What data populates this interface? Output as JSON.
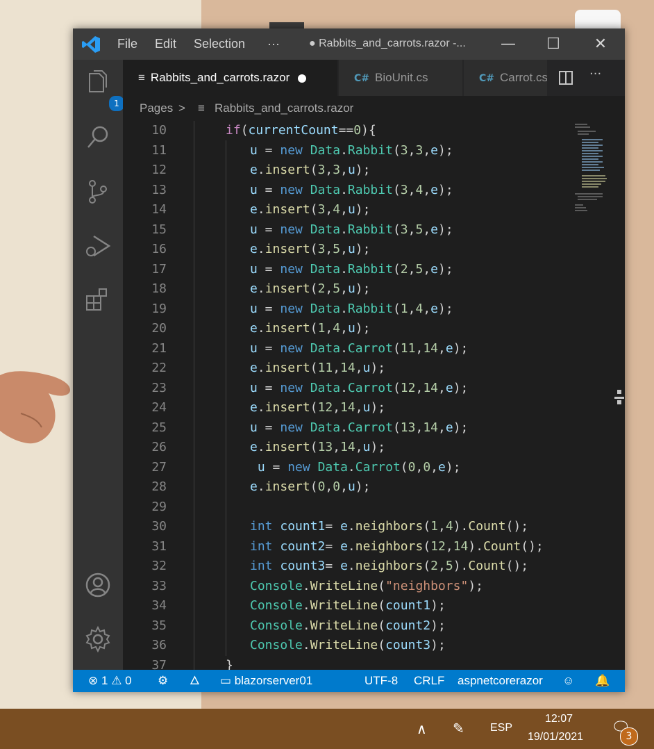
{
  "window": {
    "menu": [
      "File",
      "Edit",
      "Selection",
      "···"
    ],
    "title": "● Rabbits_and_carrots.razor -...",
    "controls": [
      "—",
      "☐",
      "✕"
    ]
  },
  "activity": {
    "explorer_badge": "1"
  },
  "tabs": [
    {
      "label": "Rabbits_and_carrots.razor",
      "modified": true,
      "active": true
    },
    {
      "label": "BioUnit.cs",
      "active": false
    },
    {
      "label": "Carrot.cs",
      "active": false
    }
  ],
  "tab_actions": {
    "more": "···"
  },
  "breadcrumb": {
    "folder": "Pages",
    "separator": ">",
    "file": "Rabbits_and_carrots.razor"
  },
  "code": [
    {
      "n": "10",
      "indent": 0,
      "parts": [
        [
          "ctrl",
          "if"
        ],
        [
          "pun",
          "("
        ],
        [
          "var",
          "currentCount"
        ],
        [
          "pun",
          "=="
        ],
        [
          "num",
          "0"
        ],
        [
          "pun",
          "){"
        ]
      ]
    },
    {
      "n": "11",
      "indent": 1,
      "parts": [
        [
          "var",
          "u"
        ],
        [
          "pun",
          " = "
        ],
        [
          "kw",
          "new"
        ],
        [
          "pun",
          " "
        ],
        [
          "typ",
          "Data"
        ],
        [
          "pun",
          "."
        ],
        [
          "typ",
          "Rabbit"
        ],
        [
          "pun",
          "("
        ],
        [
          "num",
          "3"
        ],
        [
          "pun",
          ","
        ],
        [
          "num",
          "3"
        ],
        [
          "pun",
          ","
        ],
        [
          "var",
          "e"
        ],
        [
          "pun",
          ");"
        ]
      ]
    },
    {
      "n": "12",
      "indent": 1,
      "parts": [
        [
          "var",
          "e"
        ],
        [
          "pun",
          "."
        ],
        [
          "fn",
          "insert"
        ],
        [
          "pun",
          "("
        ],
        [
          "num",
          "3"
        ],
        [
          "pun",
          ","
        ],
        [
          "num",
          "3"
        ],
        [
          "pun",
          ","
        ],
        [
          "var",
          "u"
        ],
        [
          "pun",
          ");"
        ]
      ]
    },
    {
      "n": "13",
      "indent": 1,
      "parts": [
        [
          "var",
          "u"
        ],
        [
          "pun",
          " = "
        ],
        [
          "kw",
          "new"
        ],
        [
          "pun",
          " "
        ],
        [
          "typ",
          "Data"
        ],
        [
          "pun",
          "."
        ],
        [
          "typ",
          "Rabbit"
        ],
        [
          "pun",
          "("
        ],
        [
          "num",
          "3"
        ],
        [
          "pun",
          ","
        ],
        [
          "num",
          "4"
        ],
        [
          "pun",
          ","
        ],
        [
          "var",
          "e"
        ],
        [
          "pun",
          ");"
        ]
      ]
    },
    {
      "n": "14",
      "indent": 1,
      "parts": [
        [
          "var",
          "e"
        ],
        [
          "pun",
          "."
        ],
        [
          "fn",
          "insert"
        ],
        [
          "pun",
          "("
        ],
        [
          "num",
          "3"
        ],
        [
          "pun",
          ","
        ],
        [
          "num",
          "4"
        ],
        [
          "pun",
          ","
        ],
        [
          "var",
          "u"
        ],
        [
          "pun",
          ");"
        ]
      ]
    },
    {
      "n": "15",
      "indent": 1,
      "parts": [
        [
          "var",
          "u"
        ],
        [
          "pun",
          " = "
        ],
        [
          "kw",
          "new"
        ],
        [
          "pun",
          " "
        ],
        [
          "typ",
          "Data"
        ],
        [
          "pun",
          "."
        ],
        [
          "typ",
          "Rabbit"
        ],
        [
          "pun",
          "("
        ],
        [
          "num",
          "3"
        ],
        [
          "pun",
          ","
        ],
        [
          "num",
          "5"
        ],
        [
          "pun",
          ","
        ],
        [
          "var",
          "e"
        ],
        [
          "pun",
          ");"
        ]
      ]
    },
    {
      "n": "16",
      "indent": 1,
      "parts": [
        [
          "var",
          "e"
        ],
        [
          "pun",
          "."
        ],
        [
          "fn",
          "insert"
        ],
        [
          "pun",
          "("
        ],
        [
          "num",
          "3"
        ],
        [
          "pun",
          ","
        ],
        [
          "num",
          "5"
        ],
        [
          "pun",
          ","
        ],
        [
          "var",
          "u"
        ],
        [
          "pun",
          ");"
        ]
      ]
    },
    {
      "n": "17",
      "indent": 1,
      "parts": [
        [
          "var",
          "u"
        ],
        [
          "pun",
          " = "
        ],
        [
          "kw",
          "new"
        ],
        [
          "pun",
          " "
        ],
        [
          "typ",
          "Data"
        ],
        [
          "pun",
          "."
        ],
        [
          "typ",
          "Rabbit"
        ],
        [
          "pun",
          "("
        ],
        [
          "num",
          "2"
        ],
        [
          "pun",
          ","
        ],
        [
          "num",
          "5"
        ],
        [
          "pun",
          ","
        ],
        [
          "var",
          "e"
        ],
        [
          "pun",
          ");"
        ]
      ]
    },
    {
      "n": "18",
      "indent": 1,
      "parts": [
        [
          "var",
          "e"
        ],
        [
          "pun",
          "."
        ],
        [
          "fn",
          "insert"
        ],
        [
          "pun",
          "("
        ],
        [
          "num",
          "2"
        ],
        [
          "pun",
          ","
        ],
        [
          "num",
          "5"
        ],
        [
          "pun",
          ","
        ],
        [
          "var",
          "u"
        ],
        [
          "pun",
          ");"
        ]
      ]
    },
    {
      "n": "19",
      "indent": 1,
      "parts": [
        [
          "var",
          "u"
        ],
        [
          "pun",
          " = "
        ],
        [
          "kw",
          "new"
        ],
        [
          "pun",
          " "
        ],
        [
          "typ",
          "Data"
        ],
        [
          "pun",
          "."
        ],
        [
          "typ",
          "Rabbit"
        ],
        [
          "pun",
          "("
        ],
        [
          "num",
          "1"
        ],
        [
          "pun",
          ","
        ],
        [
          "num",
          "4"
        ],
        [
          "pun",
          ","
        ],
        [
          "var",
          "e"
        ],
        [
          "pun",
          ");"
        ]
      ]
    },
    {
      "n": "20",
      "indent": 1,
      "parts": [
        [
          "var",
          "e"
        ],
        [
          "pun",
          "."
        ],
        [
          "fn",
          "insert"
        ],
        [
          "pun",
          "("
        ],
        [
          "num",
          "1"
        ],
        [
          "pun",
          ","
        ],
        [
          "num",
          "4"
        ],
        [
          "pun",
          ","
        ],
        [
          "var",
          "u"
        ],
        [
          "pun",
          ");"
        ]
      ]
    },
    {
      "n": "21",
      "indent": 1,
      "parts": [
        [
          "var",
          "u"
        ],
        [
          "pun",
          " = "
        ],
        [
          "kw",
          "new"
        ],
        [
          "pun",
          " "
        ],
        [
          "typ",
          "Data"
        ],
        [
          "pun",
          "."
        ],
        [
          "typ",
          "Carrot"
        ],
        [
          "pun",
          "("
        ],
        [
          "num",
          "11"
        ],
        [
          "pun",
          ","
        ],
        [
          "num",
          "14"
        ],
        [
          "pun",
          ","
        ],
        [
          "var",
          "e"
        ],
        [
          "pun",
          ");"
        ]
      ]
    },
    {
      "n": "22",
      "indent": 1,
      "parts": [
        [
          "var",
          "e"
        ],
        [
          "pun",
          "."
        ],
        [
          "fn",
          "insert"
        ],
        [
          "pun",
          "("
        ],
        [
          "num",
          "11"
        ],
        [
          "pun",
          ","
        ],
        [
          "num",
          "14"
        ],
        [
          "pun",
          ","
        ],
        [
          "var",
          "u"
        ],
        [
          "pun",
          ");"
        ]
      ]
    },
    {
      "n": "23",
      "indent": 1,
      "parts": [
        [
          "var",
          "u"
        ],
        [
          "pun",
          " = "
        ],
        [
          "kw",
          "new"
        ],
        [
          "pun",
          " "
        ],
        [
          "typ",
          "Data"
        ],
        [
          "pun",
          "."
        ],
        [
          "typ",
          "Carrot"
        ],
        [
          "pun",
          "("
        ],
        [
          "num",
          "12"
        ],
        [
          "pun",
          ","
        ],
        [
          "num",
          "14"
        ],
        [
          "pun",
          ","
        ],
        [
          "var",
          "e"
        ],
        [
          "pun",
          ");"
        ]
      ]
    },
    {
      "n": "24",
      "indent": 1,
      "parts": [
        [
          "var",
          "e"
        ],
        [
          "pun",
          "."
        ],
        [
          "fn",
          "insert"
        ],
        [
          "pun",
          "("
        ],
        [
          "num",
          "12"
        ],
        [
          "pun",
          ","
        ],
        [
          "num",
          "14"
        ],
        [
          "pun",
          ","
        ],
        [
          "var",
          "u"
        ],
        [
          "pun",
          ");"
        ]
      ]
    },
    {
      "n": "25",
      "indent": 1,
      "parts": [
        [
          "var",
          "u"
        ],
        [
          "pun",
          " = "
        ],
        [
          "kw",
          "new"
        ],
        [
          "pun",
          " "
        ],
        [
          "typ",
          "Data"
        ],
        [
          "pun",
          "."
        ],
        [
          "typ",
          "Carrot"
        ],
        [
          "pun",
          "("
        ],
        [
          "num",
          "13"
        ],
        [
          "pun",
          ","
        ],
        [
          "num",
          "14"
        ],
        [
          "pun",
          ","
        ],
        [
          "var",
          "e"
        ],
        [
          "pun",
          ");"
        ]
      ]
    },
    {
      "n": "26",
      "indent": 1,
      "parts": [
        [
          "var",
          "e"
        ],
        [
          "pun",
          "."
        ],
        [
          "fn",
          "insert"
        ],
        [
          "pun",
          "("
        ],
        [
          "num",
          "13"
        ],
        [
          "pun",
          ","
        ],
        [
          "num",
          "14"
        ],
        [
          "pun",
          ","
        ],
        [
          "var",
          "u"
        ],
        [
          "pun",
          ");"
        ]
      ]
    },
    {
      "n": "27",
      "indent": 1,
      "parts": [
        [
          "pun",
          " "
        ],
        [
          "var",
          "u"
        ],
        [
          "pun",
          " = "
        ],
        [
          "kw",
          "new"
        ],
        [
          "pun",
          " "
        ],
        [
          "typ",
          "Data"
        ],
        [
          "pun",
          "."
        ],
        [
          "typ",
          "Carrot"
        ],
        [
          "pun",
          "("
        ],
        [
          "num",
          "0"
        ],
        [
          "pun",
          ","
        ],
        [
          "num",
          "0"
        ],
        [
          "pun",
          ","
        ],
        [
          "var",
          "e"
        ],
        [
          "pun",
          ");"
        ]
      ]
    },
    {
      "n": "28",
      "indent": 1,
      "parts": [
        [
          "var",
          "e"
        ],
        [
          "pun",
          "."
        ],
        [
          "fn",
          "insert"
        ],
        [
          "pun",
          "("
        ],
        [
          "num",
          "0"
        ],
        [
          "pun",
          ","
        ],
        [
          "num",
          "0"
        ],
        [
          "pun",
          ","
        ],
        [
          "var",
          "u"
        ],
        [
          "pun",
          ");"
        ]
      ]
    },
    {
      "n": "29",
      "indent": 1,
      "parts": []
    },
    {
      "n": "30",
      "indent": 1,
      "parts": [
        [
          "kw",
          "int"
        ],
        [
          "pun",
          " "
        ],
        [
          "var",
          "count1"
        ],
        [
          "pun",
          "= "
        ],
        [
          "var",
          "e"
        ],
        [
          "pun",
          "."
        ],
        [
          "fn",
          "neighbors"
        ],
        [
          "pun",
          "("
        ],
        [
          "num",
          "1"
        ],
        [
          "pun",
          ","
        ],
        [
          "num",
          "4"
        ],
        [
          "pun",
          ")."
        ],
        [
          "fn",
          "Count"
        ],
        [
          "pun",
          "();"
        ]
      ]
    },
    {
      "n": "31",
      "indent": 1,
      "parts": [
        [
          "kw",
          "int"
        ],
        [
          "pun",
          " "
        ],
        [
          "var",
          "count2"
        ],
        [
          "pun",
          "= "
        ],
        [
          "var",
          "e"
        ],
        [
          "pun",
          "."
        ],
        [
          "fn",
          "neighbors"
        ],
        [
          "pun",
          "("
        ],
        [
          "num",
          "12"
        ],
        [
          "pun",
          ","
        ],
        [
          "num",
          "14"
        ],
        [
          "pun",
          ")."
        ],
        [
          "fn",
          "Count"
        ],
        [
          "pun",
          "();"
        ]
      ]
    },
    {
      "n": "32",
      "indent": 1,
      "parts": [
        [
          "kw",
          "int"
        ],
        [
          "pun",
          " "
        ],
        [
          "var",
          "count3"
        ],
        [
          "pun",
          "= "
        ],
        [
          "var",
          "e"
        ],
        [
          "pun",
          "."
        ],
        [
          "fn",
          "neighbors"
        ],
        [
          "pun",
          "("
        ],
        [
          "num",
          "2"
        ],
        [
          "pun",
          ","
        ],
        [
          "num",
          "5"
        ],
        [
          "pun",
          ")."
        ],
        [
          "fn",
          "Count"
        ],
        [
          "pun",
          "();"
        ]
      ]
    },
    {
      "n": "33",
      "indent": 1,
      "parts": [
        [
          "typ",
          "Console"
        ],
        [
          "pun",
          "."
        ],
        [
          "fn",
          "WriteLine"
        ],
        [
          "pun",
          "("
        ],
        [
          "str",
          "\"neighbors\""
        ],
        [
          "pun",
          ");"
        ]
      ]
    },
    {
      "n": "34",
      "indent": 1,
      "parts": [
        [
          "typ",
          "Console"
        ],
        [
          "pun",
          "."
        ],
        [
          "fn",
          "WriteLine"
        ],
        [
          "pun",
          "("
        ],
        [
          "var",
          "count1"
        ],
        [
          "pun",
          ");"
        ]
      ]
    },
    {
      "n": "35",
      "indent": 1,
      "parts": [
        [
          "typ",
          "Console"
        ],
        [
          "pun",
          "."
        ],
        [
          "fn",
          "WriteLine"
        ],
        [
          "pun",
          "("
        ],
        [
          "var",
          "count2"
        ],
        [
          "pun",
          ");"
        ]
      ]
    },
    {
      "n": "36",
      "indent": 1,
      "parts": [
        [
          "typ",
          "Console"
        ],
        [
          "pun",
          "."
        ],
        [
          "fn",
          "WriteLine"
        ],
        [
          "pun",
          "("
        ],
        [
          "var",
          "count3"
        ],
        [
          "pun",
          ");"
        ]
      ]
    },
    {
      "n": "37",
      "indent": 0,
      "parts": [
        [
          "pun",
          "}"
        ]
      ]
    }
  ],
  "status": {
    "errors": "1",
    "warnings": "0",
    "folder": "blazorserver01",
    "encoding": "UTF-8",
    "eol": "CRLF",
    "language": "aspnetcorerazor"
  },
  "taskbar": {
    "chevron": "∧",
    "lang": "ESP",
    "time": "12:07",
    "date": "19/01/2021",
    "notifications": "3"
  },
  "colors": {
    "accent": "#007acc",
    "editor_bg": "#1e1e1e",
    "keyword": "#569cd6",
    "type": "#4ec9b0",
    "function": "#dcdcaa",
    "number": "#b5cea8",
    "string": "#ce9178",
    "variable": "#9cdcfe"
  }
}
